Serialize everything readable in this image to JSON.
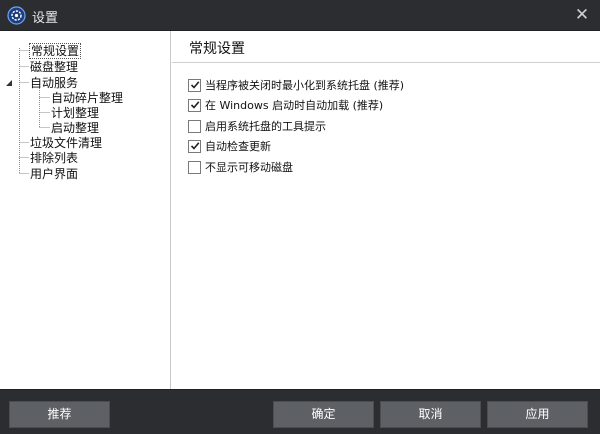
{
  "window": {
    "title": "设置",
    "app_icon": "gear-disk-icon",
    "close_glyph": "✕"
  },
  "tree": {
    "items": [
      {
        "label": "常规设置",
        "selected": true
      },
      {
        "label": "磁盘整理"
      },
      {
        "label": "自动服务",
        "expanded": true
      },
      {
        "label": "自动碎片整理"
      },
      {
        "label": "计划整理"
      },
      {
        "label": "启动整理"
      },
      {
        "label": "垃圾文件清理"
      },
      {
        "label": "排除列表"
      },
      {
        "label": "用户界面"
      }
    ]
  },
  "main": {
    "section_title": "常规设置",
    "options": [
      {
        "label": "当程序被关闭时最小化到系统托盘 (推荐)",
        "checked": true
      },
      {
        "label": "在 Windows 启动时自动加载 (推荐)",
        "checked": true
      },
      {
        "label": "启用系统托盘的工具提示",
        "checked": false
      },
      {
        "label": "自动检查更新",
        "checked": true
      },
      {
        "label": "不显示可移动磁盘",
        "checked": false
      }
    ]
  },
  "footer": {
    "recommend_label": "推荐",
    "ok_label": "确定",
    "cancel_label": "取消",
    "apply_label": "应用"
  },
  "colors": {
    "titlebar": "#2b2d31",
    "button": "#5d6064",
    "border": "#c8c8c8"
  }
}
